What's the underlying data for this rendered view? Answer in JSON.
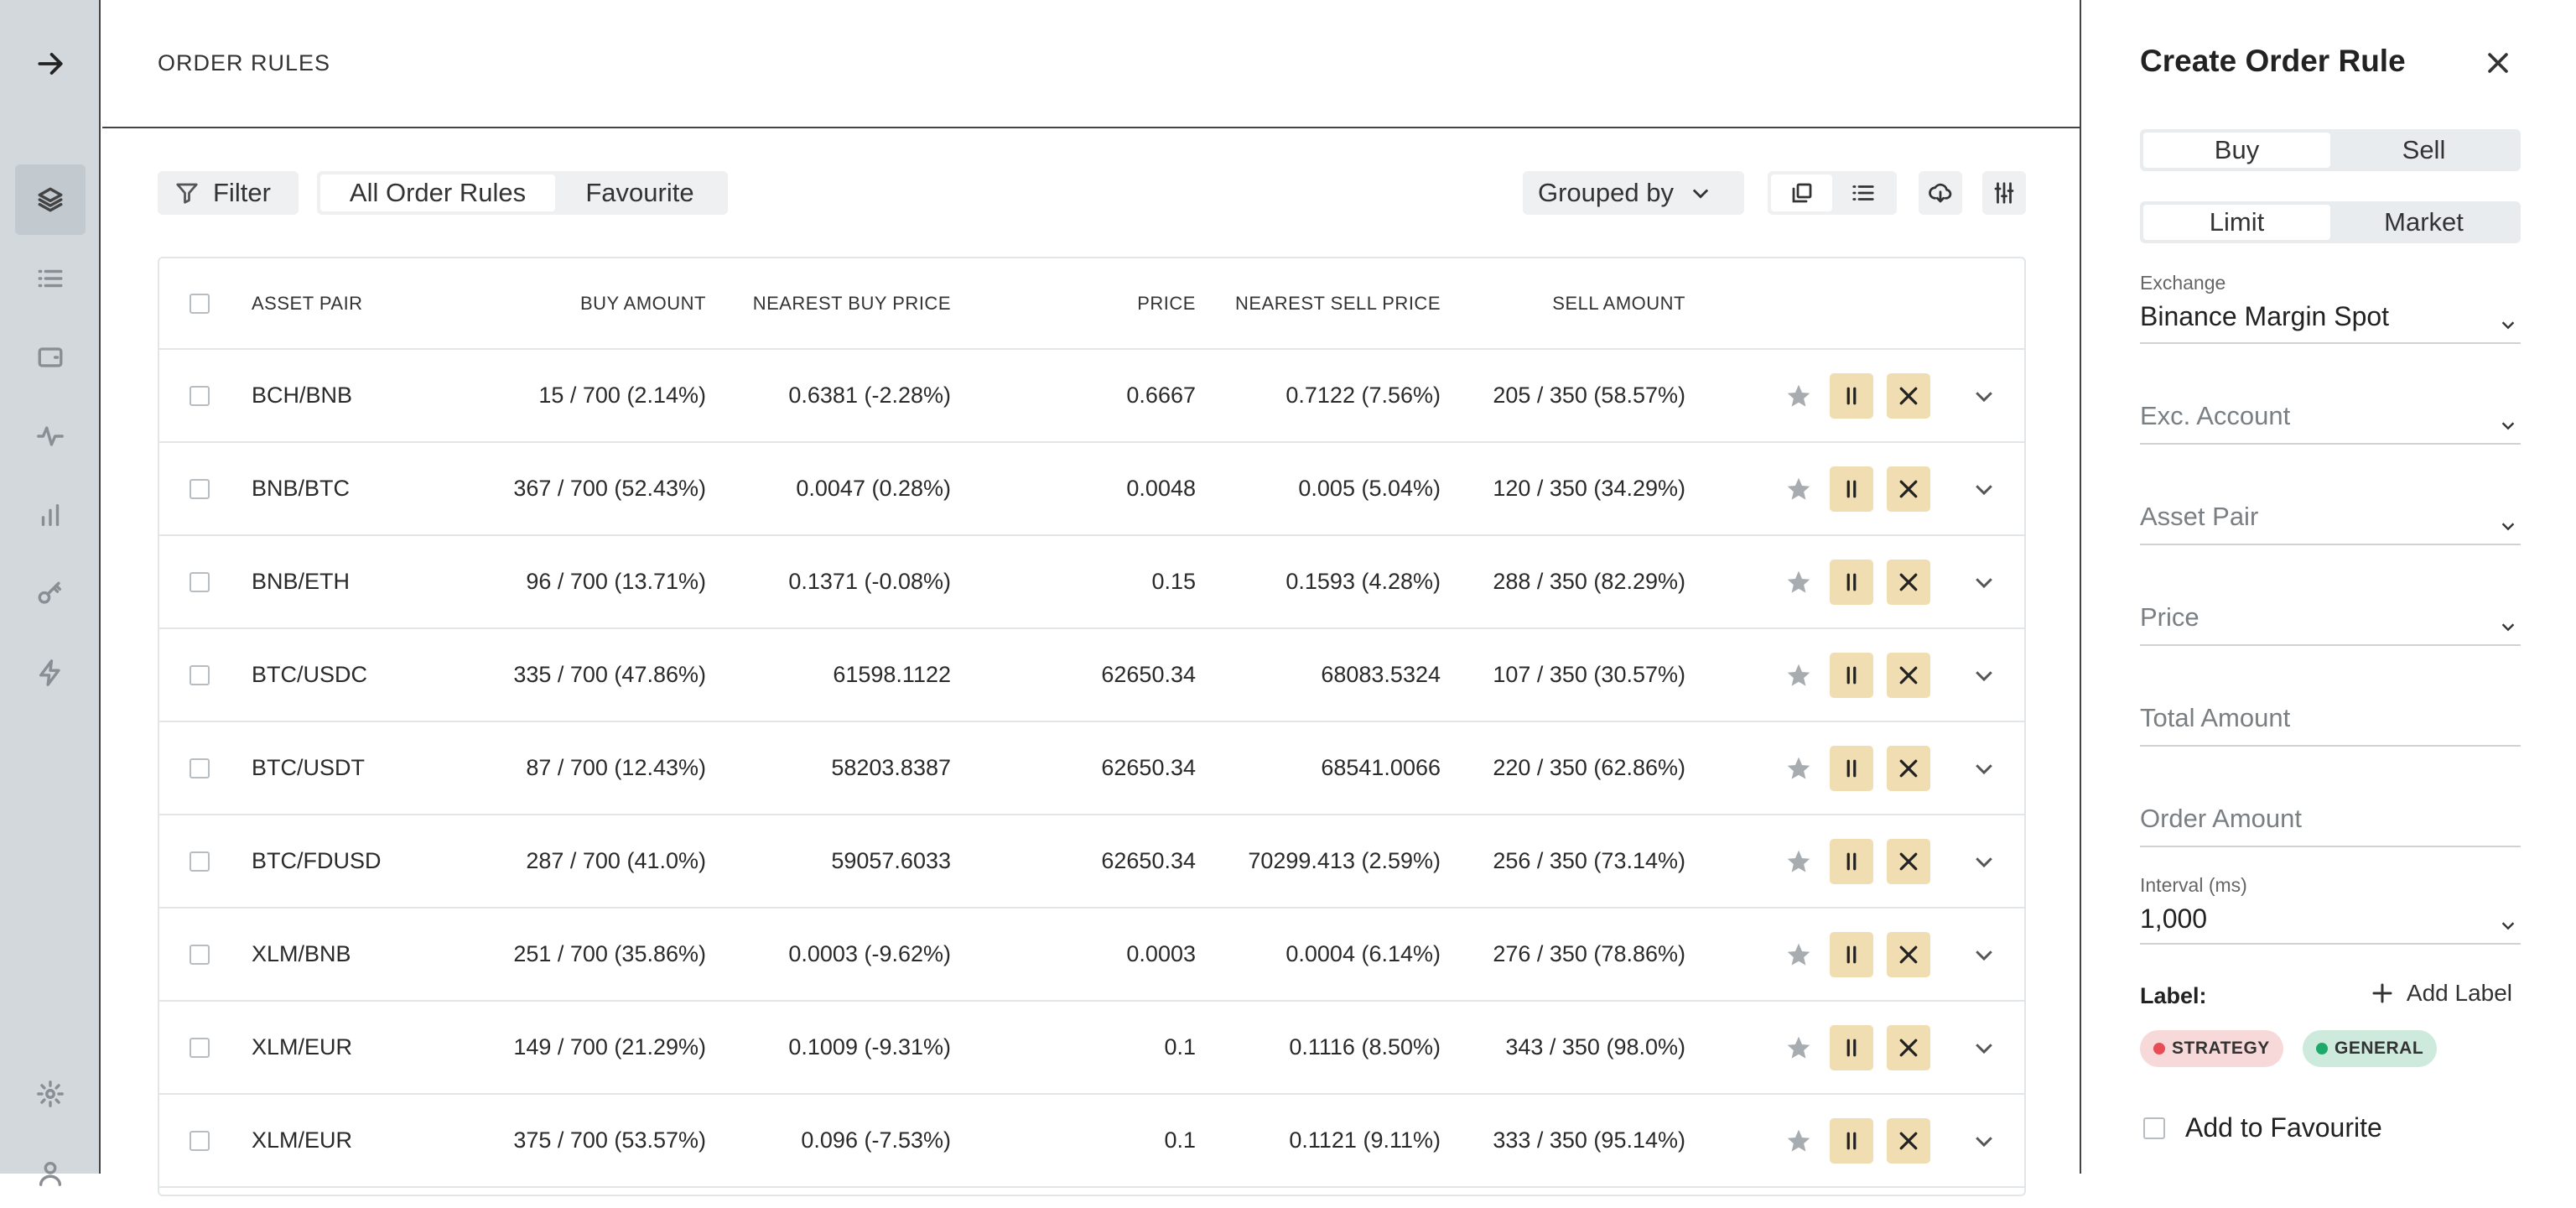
{
  "rail": {
    "items": [
      "arrow-right-icon",
      "layers-icon",
      "list-icon",
      "wallet-icon",
      "activity-icon",
      "bar-chart-icon",
      "key-icon",
      "lightning-icon",
      "settings-icon",
      "user-icon"
    ]
  },
  "header": {
    "title": "ORDER RULES"
  },
  "toolbar": {
    "filter_label": "Filter",
    "tabs": [
      "All Order Rules",
      "Favourite"
    ],
    "grouped_label": "Grouped by"
  },
  "table": {
    "columns": [
      "ASSET PAIR",
      "BUY AMOUNT",
      "NEAREST BUY PRICE",
      "PRICE",
      "NEAREST SELL PRICE",
      "SELL AMOUNT"
    ],
    "rows": [
      {
        "pair": "BCH/BNB",
        "buy": "15 / 700 (2.14%)",
        "nbp": "0.6381 (-2.28%)",
        "price": "0.6667",
        "nsp": "0.7122 (7.56%)",
        "sell": "205 / 350 (58.57%)"
      },
      {
        "pair": "BNB/BTC",
        "buy": "367 / 700 (52.43%)",
        "nbp": "0.0047 (0.28%)",
        "price": "0.0048",
        "nsp": "0.005 (5.04%)",
        "sell": "120 / 350 (34.29%)"
      },
      {
        "pair": "BNB/ETH",
        "buy": "96 / 700 (13.71%)",
        "nbp": "0.1371 (-0.08%)",
        "price": "0.15",
        "nsp": "0.1593 (4.28%)",
        "sell": "288 / 350 (82.29%)"
      },
      {
        "pair": "BTC/USDC",
        "buy": "335 / 700 (47.86%)",
        "nbp": "61598.1122",
        "price": "62650.34",
        "nsp": "68083.5324",
        "sell": "107 / 350 (30.57%)"
      },
      {
        "pair": "BTC/USDT",
        "buy": "87 / 700 (12.43%)",
        "nbp": "58203.8387",
        "price": "62650.34",
        "nsp": "68541.0066",
        "sell": "220 / 350 (62.86%)"
      },
      {
        "pair": "BTC/FDUSD",
        "buy": "287 / 700 (41.0%)",
        "nbp": "59057.6033",
        "price": "62650.34",
        "nsp": "70299.413 (2.59%)",
        "sell": "256 / 350 (73.14%)"
      },
      {
        "pair": "XLM/BNB",
        "buy": "251 / 700 (35.86%)",
        "nbp": "0.0003 (-9.62%)",
        "price": "0.0003",
        "nsp": "0.0004 (6.14%)",
        "sell": "276 / 350 (78.86%)"
      },
      {
        "pair": "XLM/EUR",
        "buy": "149 / 700 (21.29%)",
        "nbp": "0.1009 (-9.31%)",
        "price": "0.1",
        "nsp": "0.1116 (8.50%)",
        "sell": "343 / 350 (98.0%)"
      },
      {
        "pair": "XLM/EUR",
        "buy": "375 / 700 (53.57%)",
        "nbp": "0.096 (-7.53%)",
        "price": "0.1",
        "nsp": "0.1121 (9.11%)",
        "sell": "333 / 350 (95.14%)"
      }
    ]
  },
  "panel": {
    "title": "Create Order Rule",
    "side": [
      "Buy",
      "Sell"
    ],
    "type": [
      "Limit",
      "Market"
    ],
    "exchange_label": "Exchange",
    "exchange_value": "Binance Margin Spot",
    "exc_account_placeholder": "Exc. Account",
    "asset_pair_placeholder": "Asset Pair",
    "price_placeholder": "Price",
    "total_amount_placeholder": "Total Amount",
    "order_amount_placeholder": "Order Amount",
    "interval_label": "Interval (ms)",
    "interval_value": "1,000",
    "label_title": "Label:",
    "add_label": "Add Label",
    "chips": [
      "STRATEGY",
      "GENERAL"
    ],
    "favourite_label": "Add to Favourite"
  },
  "colors": {
    "rail_bg": "#d2d8dc",
    "action_bg": "#f1ddb2",
    "strategy_dot": "#e84c54",
    "general_dot": "#1ea86a"
  }
}
